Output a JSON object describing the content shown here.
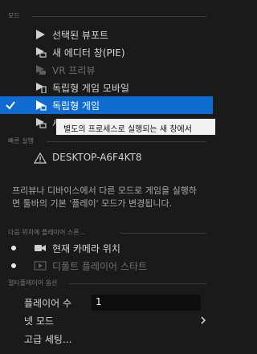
{
  "sections": {
    "mode": "모드",
    "quick_launch": "빠른 실행",
    "spawn_location": "다음 위치에 플레이어 스폰...",
    "multiplayer": "멀티플레이어 옵션"
  },
  "modes": [
    {
      "label": "선택된 뷰포트"
    },
    {
      "label": "새 에디터 창(PIE)"
    },
    {
      "label": "VR 프리뷰"
    },
    {
      "label": "독립형 게임 모바일"
    },
    {
      "label": "독립형 게임"
    },
    {
      "label": "새"
    }
  ],
  "tooltip": "별도의 프로세스로 실행되는 새 창에서",
  "quick_launch": {
    "device": "DESKTOP-A6F4KT8"
  },
  "description": "프리뷰나 디바이스에서 다른 모드로 게임을 실행하면 툴바의 기본 '플레이' 모드가 변경됩니다.",
  "spawn": [
    {
      "label": "현재 카메라 위치"
    },
    {
      "label": "디폴트 플레이어 스타트"
    }
  ],
  "multiplayer": {
    "players_label": "플레이어 수",
    "players_value": "1",
    "net_mode_label": "넷 모드",
    "advanced_label": "고급 세팅..."
  },
  "colors": {
    "background": "#1a1a1a",
    "selected": "#0e6bd0",
    "tooltip_bg": "#f2f2f2"
  }
}
